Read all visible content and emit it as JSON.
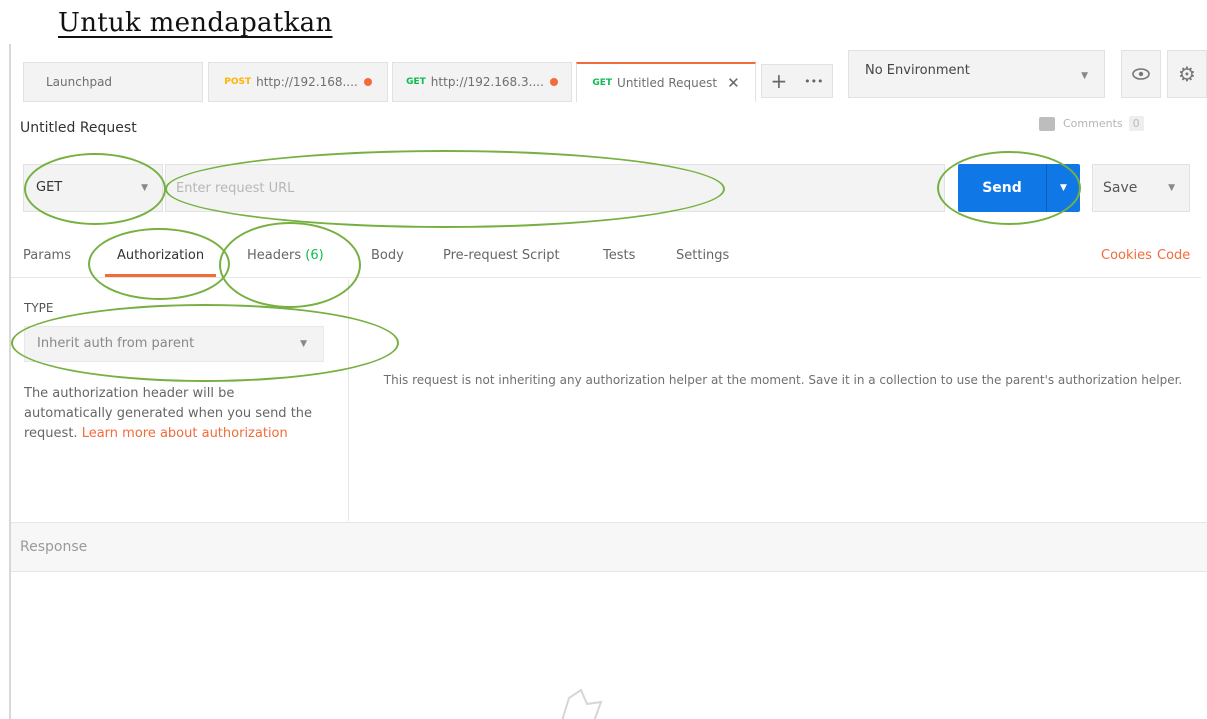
{
  "doc": {
    "heading": "Untuk mendapatkan "
  },
  "tabs": [
    {
      "label": "Launchpad"
    },
    {
      "method": "POST",
      "label": "http://192.168...."
    },
    {
      "method": "GET",
      "label": "http://192.168.3...."
    },
    {
      "method": "GET",
      "label": "Untitled Request"
    }
  ],
  "tab_tools": {
    "add": "+",
    "more": "•••"
  },
  "environment": {
    "label": "No Environment"
  },
  "request": {
    "title": "Untitled Request",
    "comments_label": "Comments",
    "comments_count": "0",
    "method": "GET",
    "url_placeholder": "Enter request URL",
    "send_label": "Send",
    "save_label": "Save"
  },
  "subtabs": {
    "params": "Params",
    "authorization": "Authorization",
    "headers": "Headers",
    "headers_count": "(6)",
    "body": "Body",
    "prerequest": "Pre-request Script",
    "tests": "Tests",
    "settings": "Settings",
    "cookies": "Cookies",
    "code": "Code"
  },
  "auth": {
    "type_label": "TYPE",
    "type_value": "Inherit auth from parent",
    "desc": "The authorization header will be automatically generated when you send the request. ",
    "learn_more": "Learn more about authorization",
    "message": "This request is not inheriting any authorization helper at the moment. Save it in a collection to use the parent's authorization helper."
  },
  "response": {
    "label": "Response"
  },
  "colors": {
    "accent": "#f26b3a",
    "send": "#0f78e6",
    "get": "#0cbb52",
    "post": "#ffb400",
    "annotation": "#76b041"
  },
  "icons": [
    "close-icon",
    "plus-icon",
    "more-icon",
    "chevron-down-icon",
    "eye-icon",
    "gear-icon",
    "comment-icon",
    "rocket-icon"
  ]
}
